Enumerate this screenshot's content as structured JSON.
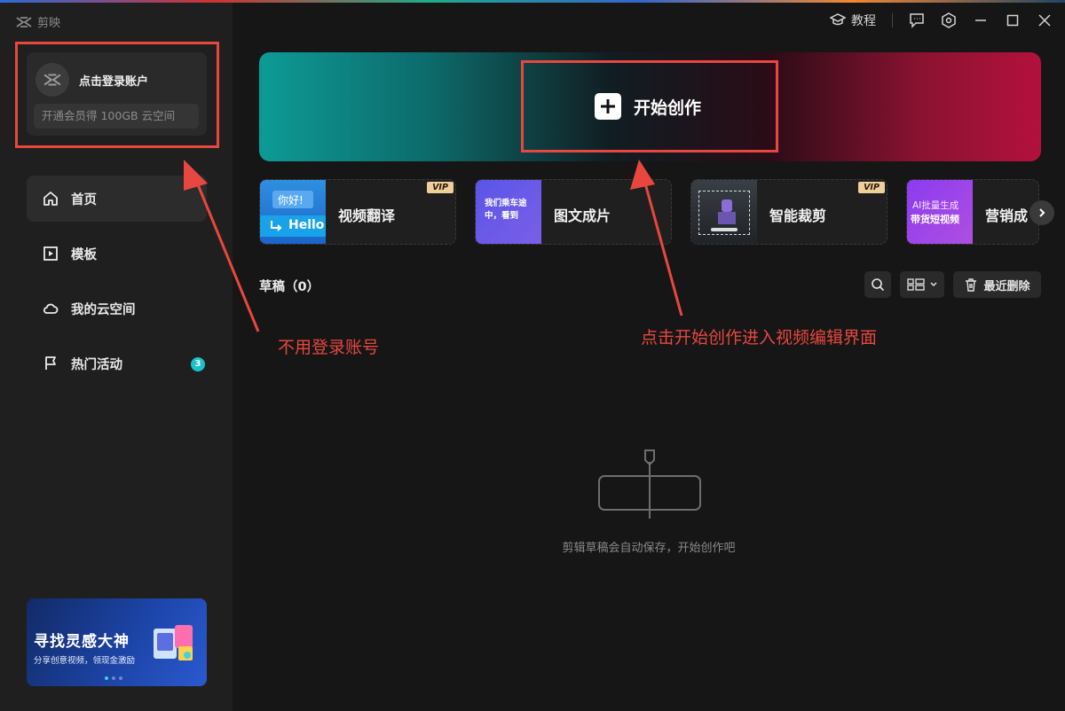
{
  "app": {
    "logo_text": "剪映"
  },
  "titlebar": {
    "tutorial_label": "教程"
  },
  "account": {
    "login_label": "点击登录账户",
    "vip_offer": "开通会员得 100GB 云空间"
  },
  "nav": [
    {
      "label": "首页",
      "icon": "home-icon",
      "active": true
    },
    {
      "label": "模板",
      "icon": "template-icon"
    },
    {
      "label": "我的云空间",
      "icon": "cloud-icon"
    },
    {
      "label": "热门活动",
      "icon": "flag-icon",
      "badge": "3"
    }
  ],
  "promo": {
    "title": "寻找灵感大神",
    "subtitle": "分享创意视频，领现金激励"
  },
  "hero": {
    "create_label": "开始创作"
  },
  "tools": [
    {
      "label": "视频翻译",
      "vip": "VIP",
      "thumb_text_top": "你好!",
      "thumb_text_bottom": "Hello"
    },
    {
      "label": "图文成片",
      "thumb_text": "我们乘车途\n中，看到"
    },
    {
      "label": "智能裁剪",
      "vip": "VIP"
    },
    {
      "label": "营销成",
      "thumb_text_top": "AI批量生成",
      "thumb_text_bottom": "带货短视频"
    }
  ],
  "drafts": {
    "title": "草稿（0）",
    "recent_delete_label": "最近删除",
    "empty_hint": "剪辑草稿会自动保存，开始创作吧"
  },
  "annotations": {
    "no_login_note": "不用登录账号",
    "create_note": "点击开始创作进入视频编辑界面"
  },
  "colors": {
    "annotation_red": "#e8473f",
    "badge_cyan": "#19c2c9",
    "vip_gold": "#efcf9c"
  }
}
